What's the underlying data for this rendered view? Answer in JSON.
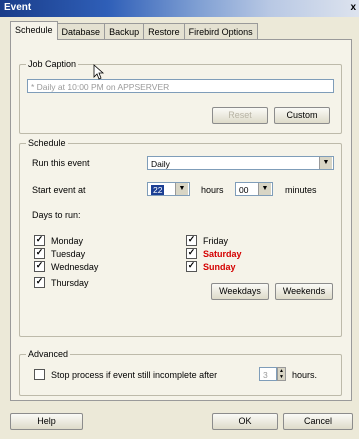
{
  "window": {
    "title": "Event",
    "close_glyph": "x"
  },
  "tabs": [
    {
      "label": "Schedule",
      "active": true
    },
    {
      "label": "Database"
    },
    {
      "label": "Backup"
    },
    {
      "label": "Restore"
    },
    {
      "label": "Firebird Options"
    }
  ],
  "job_caption": {
    "legend": "Job Caption",
    "value": "* Daily at 10:00 PM on APPSERVER",
    "reset_label": "Reset",
    "custom_label": "Custom"
  },
  "schedule": {
    "legend": "Schedule",
    "run_label": "Run this event",
    "run_value": "Daily",
    "start_label": "Start event at",
    "hours_value": "22",
    "hours_label": "hours",
    "minutes_value": "00",
    "minutes_label": "minutes",
    "days_label": "Days to run:",
    "days": [
      {
        "label": "Monday",
        "checked": true,
        "weekend": false
      },
      {
        "label": "Tuesday",
        "checked": true,
        "weekend": false
      },
      {
        "label": "Wednesday",
        "checked": true,
        "weekend": false
      },
      {
        "label": "Thursday",
        "checked": true,
        "weekend": false
      },
      {
        "label": "Friday",
        "checked": true,
        "weekend": false
      },
      {
        "label": "Saturday",
        "checked": true,
        "weekend": true
      },
      {
        "label": "Sunday",
        "checked": true,
        "weekend": true
      }
    ],
    "weekdays_label": "Weekdays",
    "weekends_label": "Weekends"
  },
  "advanced": {
    "legend": "Advanced",
    "stop_label": "Stop process if event still incomplete after",
    "stop_checked": false,
    "hours_value": "3",
    "hours_label": "hours."
  },
  "footer": {
    "help_label": "Help",
    "ok_label": "OK",
    "cancel_label": "Cancel"
  }
}
